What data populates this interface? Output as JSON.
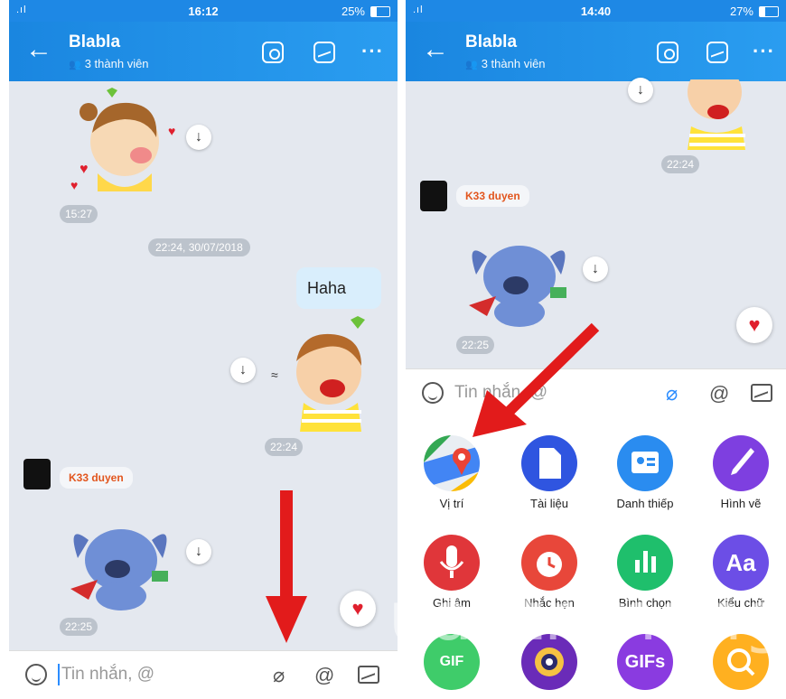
{
  "left": {
    "status": {
      "signal": ".ıl",
      "time": "16:12",
      "battery": "25%"
    },
    "header": {
      "title": "Blabla",
      "members": "3 thành viên"
    },
    "messages": {
      "time1": "15:27",
      "date_divider": "22:24, 30/07/2018",
      "bubble_text": "Haha",
      "time2": "22:24",
      "sender": "K33 duyen",
      "time3": "22:25"
    },
    "input": {
      "placeholder": "Tin nhắn, @",
      "at": "@"
    }
  },
  "right": {
    "status": {
      "signal": ".ıl",
      "time": "14:40",
      "battery": "27%"
    },
    "header": {
      "title": "Blabla",
      "members": "3 thành viên"
    },
    "messages": {
      "time1": "22:24",
      "sender": "K33 duyen",
      "time2": "22:25"
    },
    "input": {
      "placeholder": "Tin nhắn, @",
      "at": "@"
    },
    "tools": [
      {
        "label": "Vị trí",
        "color": "#e9eef3",
        "icon": "map-pin"
      },
      {
        "label": "Tài liệu",
        "color": "#2f55e0",
        "icon": "document"
      },
      {
        "label": "Danh thiếp",
        "color": "#2a8cf0",
        "icon": "contact-card"
      },
      {
        "label": "Hình vẽ",
        "color": "#7e3fe0",
        "icon": "brush"
      },
      {
        "label": "Ghi âm",
        "color": "#e0363a",
        "icon": "microphone"
      },
      {
        "label": "Nhắc hẹn",
        "color": "#e8473a",
        "icon": "alarm-clock"
      },
      {
        "label": "Bình chọn",
        "color": "#1fbf6c",
        "icon": "poll"
      },
      {
        "label": "Kiểu chữ",
        "color": "#6c4ee6",
        "icon": "font",
        "glyph": "Aa"
      },
      {
        "label": "",
        "color": "#3fcc6a",
        "icon": "gif",
        "glyph": "GIF"
      },
      {
        "label": "",
        "color": "#6a2bb8",
        "icon": "camera-lens"
      },
      {
        "label": "",
        "color": "#8a3be0",
        "icon": "guggy-gifs",
        "glyph": "GIFs"
      },
      {
        "label": "",
        "color": "#ffb020",
        "icon": "search-sticker"
      }
    ]
  },
  "watermark": "uantrimang"
}
